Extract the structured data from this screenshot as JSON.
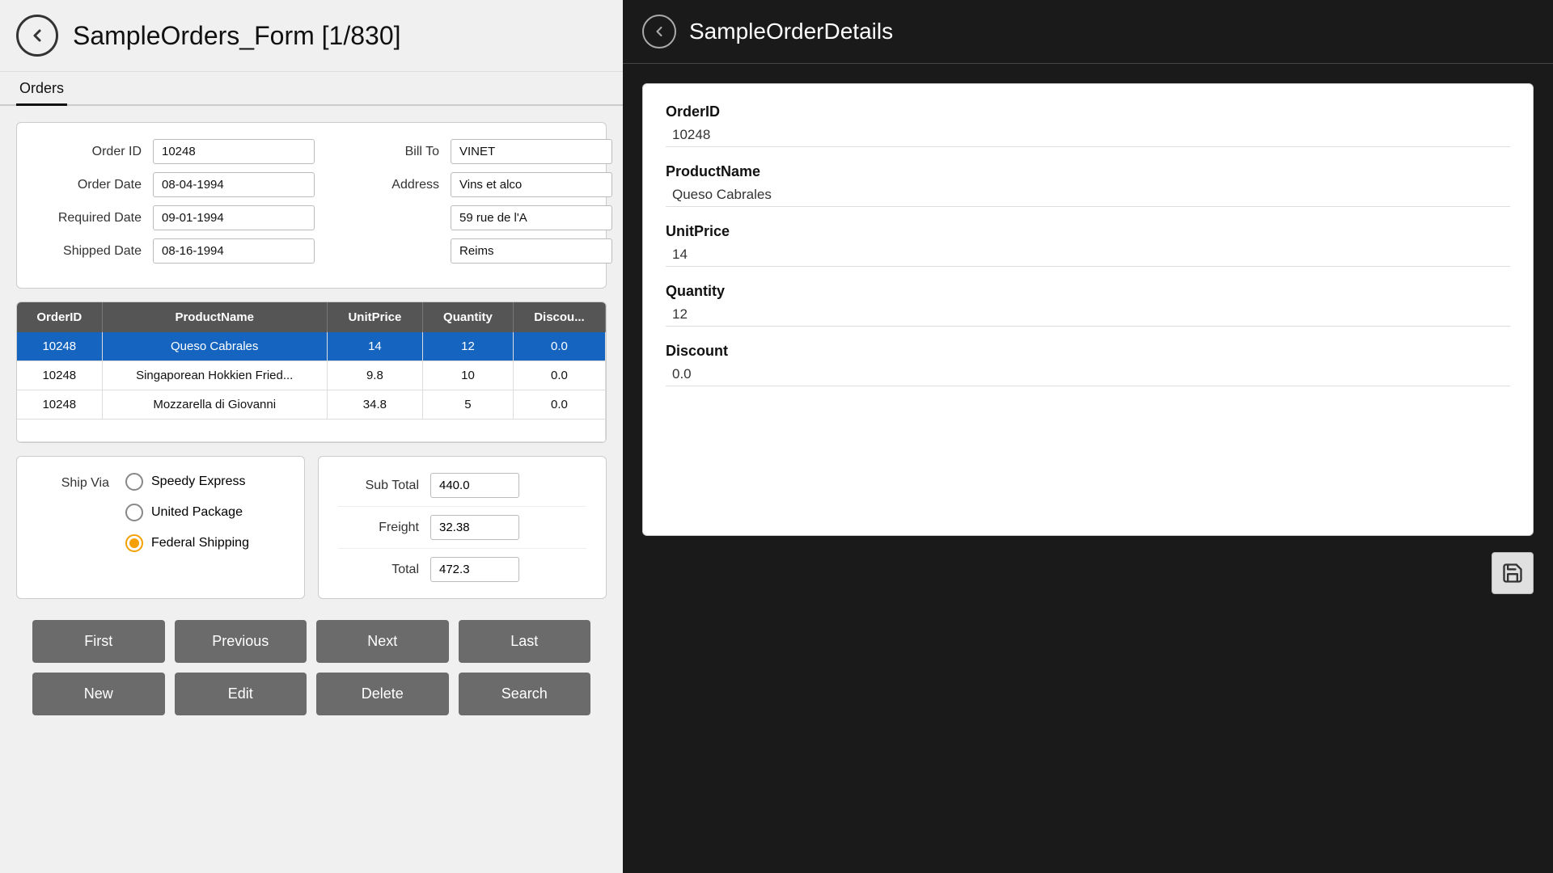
{
  "left": {
    "back_button_label": "←",
    "page_title": "SampleOrders_Form [1/830]",
    "tab_orders": "Orders",
    "form": {
      "order_id_label": "Order ID",
      "order_id_value": "10248",
      "order_date_label": "Order Date",
      "order_date_value": "08-04-1994",
      "required_date_label": "Required Date",
      "required_date_value": "09-01-1994",
      "shipped_date_label": "Shipped Date",
      "shipped_date_value": "08-16-1994",
      "bill_to_label": "Bill To",
      "bill_to_value": "VINET",
      "address_label": "Address",
      "address_value": "Vins et alco",
      "address2_value": "59 rue de l'A",
      "city_value": "Reims"
    },
    "table": {
      "columns": [
        "OrderID",
        "ProductName",
        "UnitPrice",
        "Quantity",
        "Discount"
      ],
      "rows": [
        {
          "order_id": "10248",
          "product_name": "Queso Cabrales",
          "unit_price": "14",
          "quantity": "12",
          "discount": "0.0",
          "selected": true
        },
        {
          "order_id": "10248",
          "product_name": "Singaporean Hokkien Fried...",
          "unit_price": "9.8",
          "quantity": "10",
          "discount": "0.0",
          "selected": false
        },
        {
          "order_id": "10248",
          "product_name": "Mozzarella di Giovanni",
          "unit_price": "34.8",
          "quantity": "5",
          "discount": "0.0",
          "selected": false
        }
      ]
    },
    "ship_via": {
      "label": "Ship Via",
      "options": [
        {
          "label": "Speedy Express",
          "selected": false
        },
        {
          "label": "United Package",
          "selected": false
        },
        {
          "label": "Federal Shipping",
          "selected": true
        }
      ]
    },
    "totals": {
      "sub_total_label": "Sub Total",
      "sub_total_value": "440.0",
      "freight_label": "Freight",
      "freight_value": "32.38",
      "total_label": "Total",
      "total_value": "472.3"
    },
    "nav_buttons": {
      "first": "First",
      "previous": "Previous",
      "next": "Next",
      "last": "Last",
      "new": "New",
      "edit": "Edit",
      "delete": "Delete",
      "search": "Search"
    }
  },
  "right": {
    "title": "SampleOrderDetails",
    "detail": {
      "order_id_label": "OrderID",
      "order_id_value": "10248",
      "product_name_label": "ProductName",
      "product_name_value": "Queso Cabrales",
      "unit_price_label": "UnitPrice",
      "unit_price_value": "14",
      "quantity_label": "Quantity",
      "quantity_value": "12",
      "discount_label": "Discount",
      "discount_value": "0.0"
    },
    "save_icon": "💾"
  }
}
